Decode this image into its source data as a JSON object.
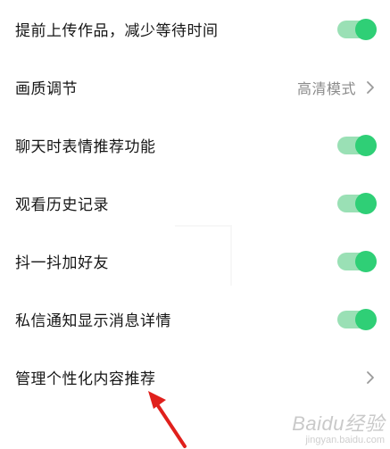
{
  "settings": {
    "items": [
      {
        "label": "提前上传作品，减少等待时间",
        "control": "toggle",
        "on": true
      },
      {
        "label": "画质调节",
        "control": "value",
        "value": "高清模式"
      },
      {
        "label": "聊天时表情推荐功能",
        "control": "toggle",
        "on": true
      },
      {
        "label": "观看历史记录",
        "control": "toggle",
        "on": true
      },
      {
        "label": "抖一抖加好友",
        "control": "toggle",
        "on": true
      },
      {
        "label": "私信通知显示消息详情",
        "control": "toggle",
        "on": true
      },
      {
        "label": "管理个性化内容推荐",
        "control": "link"
      }
    ]
  },
  "icons": {
    "chevron": "chevron-right-icon",
    "annotation": "red-arrow-annotation"
  },
  "colors": {
    "toggle_knob": "#2fcf76",
    "toggle_track": "#9ae0b5",
    "value_text": "#8a8a8a",
    "annotation_arrow": "#e0201c"
  },
  "watermark": {
    "logo": "Baidu经验",
    "sub": "jingyan.baidu.com"
  }
}
